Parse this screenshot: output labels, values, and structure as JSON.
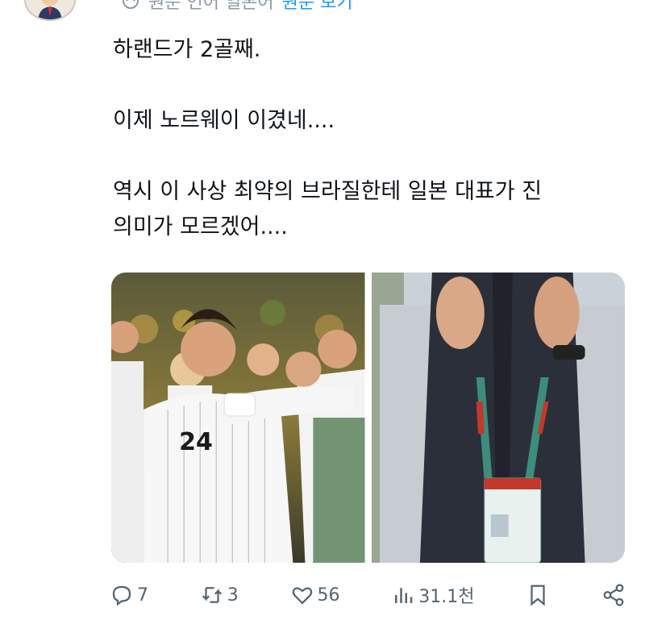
{
  "tweet": {
    "translate_text": "원문 언어 일본어",
    "translate_link": "원문 보기",
    "paragraphs": [
      "하랜드가 2골째.",
      "이제 노르웨이 이겼네....",
      "역시 이 사상 최약의 브라질한테 일본 대표가 진\n의미가 모르겠어...."
    ],
    "media": [
      {
        "icon": "soccer-celebration-photo",
        "jersey_number": "24"
      },
      {
        "icon": "clapping-man-photo"
      }
    ]
  },
  "actions": {
    "reply": {
      "icon": "reply-icon",
      "count": "7"
    },
    "retweet": {
      "icon": "retweet-icon",
      "count": "3"
    },
    "like": {
      "icon": "heart-icon",
      "count": "56"
    },
    "views": {
      "icon": "views-icon",
      "count": "31.1천"
    },
    "bookmark": {
      "icon": "bookmark-icon"
    },
    "share": {
      "icon": "share-icon"
    }
  },
  "colors": {
    "text": "#0f1419",
    "muted": "#536471",
    "link": "#1d9bf0"
  }
}
